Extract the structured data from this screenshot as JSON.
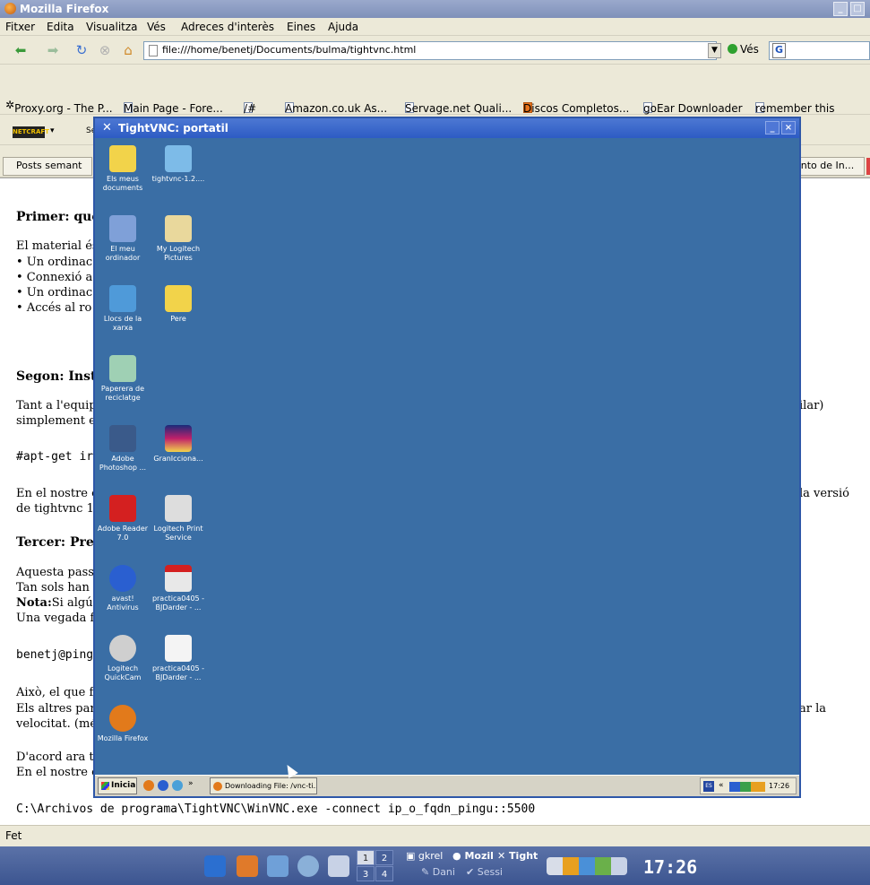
{
  "firefox": {
    "title": "Mozilla Firefox",
    "menu": [
      "Fitxer",
      "Edita",
      "Visualitza",
      "Vés",
      "Adreces d'interès",
      "Eines",
      "Ajuda"
    ],
    "url": "file:///home/benetj/Documents/bulma/tightvnc.html",
    "go_label": "Vés",
    "search_label": "G",
    "bookmarks": [
      "Proxy.org - The P...",
      "Main Page - Fore...",
      "/#",
      "Amazon.co.uk As...",
      "Servage.net Quali...",
      "Discos Completos...",
      "goEar Downloader",
      "remember this"
    ],
    "toolbar2": {
      "netcraft": "NETCRAFT",
      "sel": "Se"
    },
    "tab_left": "Posts semant",
    "tab_right": "ento de In...",
    "status": "Fet"
  },
  "page": {
    "h1": "Primer: que",
    "p1": [
      "El material és",
      "• Un ordinac",
      "• Connexió a",
      "• Un ordinac",
      "• Accés al ro"
    ],
    "h2": "Segon: Inst",
    "p2": [
      "Tant a l'equip",
      "simplement e"
    ],
    "p2_right": "ilar)",
    "cmd1": "#apt-get ir",
    "p3": [
      "En el nostre c",
      "de tightvnc 1."
    ],
    "p3_right": "la versió",
    "h3": "Tercer: Pre",
    "p4": [
      "Aquesta pass",
      "Tan sols han",
      "Nota:",
      "Si algú",
      "Una vegada fe"
    ],
    "cmd2": "benetj@ping",
    "p5": [
      "Això, el que fa",
      "Els altres par",
      "velocitat. (mé"
    ],
    "p5_right": "ar la",
    "p6": [
      "D'acord ara to",
      "En el nostre c"
    ],
    "cmd3": "C:\\Archivos de programa\\TightVNC\\WinVNC.exe -connect ip_o_fqdn_pingu::5500"
  },
  "vnc": {
    "title": "TightVNC: portatil",
    "icons_col1": [
      {
        "label": "Els meus documents",
        "icon": "folder-docs-icon",
        "color": "#f2d34a"
      },
      {
        "label": "El meu ordinador",
        "icon": "computer-icon",
        "color": "#7fa0d8"
      },
      {
        "label": "Llocs de la xarxa",
        "icon": "network-icon",
        "color": "#4f9ad9"
      },
      {
        "label": "Paperera de reciclatge",
        "icon": "recycle-bin-icon",
        "color": "#9fd0b4"
      },
      {
        "label": "Adobe Photoshop ...",
        "icon": "photoshop-icon",
        "color": "#3a5a8a"
      },
      {
        "label": "Adobe Reader 7.0",
        "icon": "adobe-reader-icon",
        "color": "#d42020"
      },
      {
        "label": "avast! Antivirus",
        "icon": "avast-icon",
        "color": "#2a5fd0"
      },
      {
        "label": "Logitech QuickCam",
        "icon": "quickcam-icon",
        "color": "#cfcfcf"
      },
      {
        "label": "Mozilla Firefox",
        "icon": "firefox-icon",
        "color": "#e27a1b"
      }
    ],
    "icons_col2": [
      {
        "label": "tightvnc-1.2....",
        "icon": "tightvnc-icon",
        "color": "#7dbbe8"
      },
      {
        "label": "My Logitech Pictures",
        "icon": "logitech-pictures-icon",
        "color": "#e9d89c"
      },
      {
        "label": "Pere",
        "icon": "folder-icon",
        "color": "#f2d34a"
      },
      {
        "label": "GranIcciona...",
        "icon": "dictionary-icon",
        "color": "#c0206a"
      },
      {
        "label": "Logitech Print Service",
        "icon": "print-service-icon",
        "color": "#dddddd"
      },
      {
        "label": "practica0405 - BJDarder - ...",
        "icon": "pdf-icon",
        "color": "#e8e8e8"
      },
      {
        "label": "practica0405 - BJDarder - ...",
        "icon": "document-icon",
        "color": "#f4f4f4"
      }
    ],
    "taskbar": {
      "start": "Inicia",
      "task": "Downloading File: /vnc-ti...",
      "lang": "ES",
      "clock": "17:26"
    }
  },
  "panel": {
    "pager": [
      "1",
      "2",
      "3",
      "4"
    ],
    "tasks": [
      "gkrel",
      "Mozil",
      "Tight",
      "Dani",
      "Sessi"
    ],
    "clock": "17:26"
  }
}
